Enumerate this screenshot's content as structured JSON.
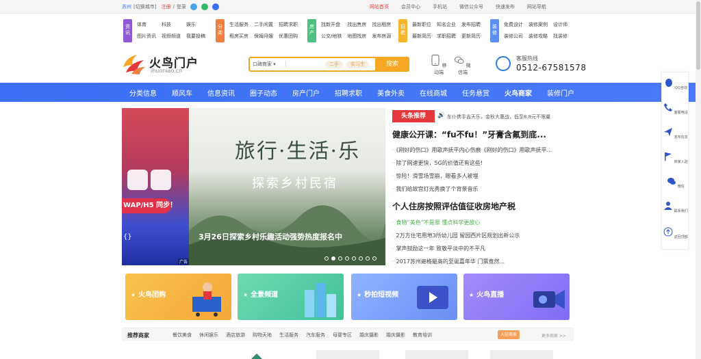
{
  "topbar": {
    "city": "苏州",
    "switch_city": "[切换城市]",
    "register": "注册",
    "login": "登录",
    "links": [
      "网站首页",
      "会员中心",
      "手机站",
      "微信公众号",
      "快速发布",
      "网站导航"
    ]
  },
  "categories": [
    {
      "tag": "资讯",
      "color": "#8e5ad7",
      "items": [
        "体育",
        "科技",
        "娱乐",
        "图片资讯",
        "视频频道",
        "我要投稿"
      ]
    },
    {
      "tag": "分类",
      "color": "#f08040",
      "items": [
        "生活服务",
        "二手闲置",
        "招聘求职",
        "租房买房",
        "保姆月嫂",
        "优惠团购"
      ]
    },
    {
      "tag": "房产",
      "color": "#4cc07e",
      "items": [
        "找新开盘",
        "找出售房",
        "找出租房",
        "公交/地铁",
        "地图找房",
        "发布房源"
      ]
    },
    {
      "tag": "招聘",
      "color": "#f5b52e",
      "items": [
        "最新职位",
        "知名企业",
        "发布招聘",
        "最新简历",
        "求职招聘",
        "更新简历"
      ]
    },
    {
      "tag": "装修",
      "color": "#5f8ef2",
      "items": [
        "免费设计",
        "装修案例",
        "设计师",
        "装修公司",
        "装修攻略",
        "找装修"
      ]
    }
  ],
  "logo": {
    "title": "火鸟门户",
    "sub": "ihuoniao.cn"
  },
  "search": {
    "category": "口碑商家",
    "placeholder": "",
    "chips": [
      "二手",
      "实习生"
    ],
    "button": "搜索"
  },
  "mobile": {
    "mobile_label": "移动端",
    "wechat_label": "微信端"
  },
  "hotline": {
    "label": "客服热线",
    "number": "0512-67581578"
  },
  "nav": [
    "分类信息",
    "顺风车",
    "信息资讯",
    "圈子动态",
    "房产门户",
    "招聘求职",
    "美食外卖",
    "在线商城",
    "任务悬赏",
    "火鸟商家",
    "装修门户"
  ],
  "nav_active_index": 9,
  "banner": {
    "headline": "旅行·生活·乐",
    "subline": "探索乡村民宿",
    "caption": "3月26日探索乡村乐趣活动强势热度报名中",
    "side_text": "WAP/H5 同步！",
    "side_brace": "{}",
    "ad": "广告",
    "slides": 8,
    "current": 2
  },
  "news": {
    "hot_label": "头条推荐",
    "marquee": "车仆携手吉天乐，金秋大惠战，低至8.8元不限量",
    "headline1": "健康公开课：“fu不fu！”牙膏含氟到底...",
    "list1": [
      "《刚好的伤口》用歌声抚平内心伤痕《刚好的伤口》用歌声抚平...",
      "除了网速更快，5G的价值还有这些!",
      "惊险！滑雪场雪崩，眼看多人被埋",
      "我们给故宫灯光秀换了个背景音乐"
    ],
    "headline2": "个人住房按照评估值征收房地产税",
    "list2": [
      "食物“美色”不是罪 懂点科学更放心",
      "2万方住宅用地3所幼儿园 留园西片区规划出新公示",
      "掌声鼓励这一年 致敬平淡中的不平凡",
      "2017苏州遍格最高的至诞嘉年华 门票竟然..."
    ]
  },
  "cards": [
    {
      "label": "火鸟团购",
      "from": "#f9c24c",
      "to": "#f6a83a"
    },
    {
      "label": "全景频道",
      "from": "#6fd9b0",
      "to": "#3fc29a"
    },
    {
      "label": "秒拍短视频",
      "from": "#8fb3ff",
      "to": "#6b8ff5"
    },
    {
      "label": "火鸟直播",
      "from": "#a48cff",
      "to": "#7f6cf2"
    }
  ],
  "merchants": {
    "title": "推荐商家",
    "items": [
      "餐饮美食",
      "休闲娱乐",
      "酒店旅游",
      "购物天地",
      "生活服务",
      "汽车服务",
      "母婴专区",
      "婚庆摄影",
      "婚庆摄影",
      "教育培训"
    ],
    "join": "入驻商家",
    "more": "更多商家 >>"
  },
  "sidebar": [
    "QQ咨询",
    "客服电话",
    "发布信息",
    "商家入驻",
    "微信",
    "联系我们",
    "返回顶部"
  ]
}
